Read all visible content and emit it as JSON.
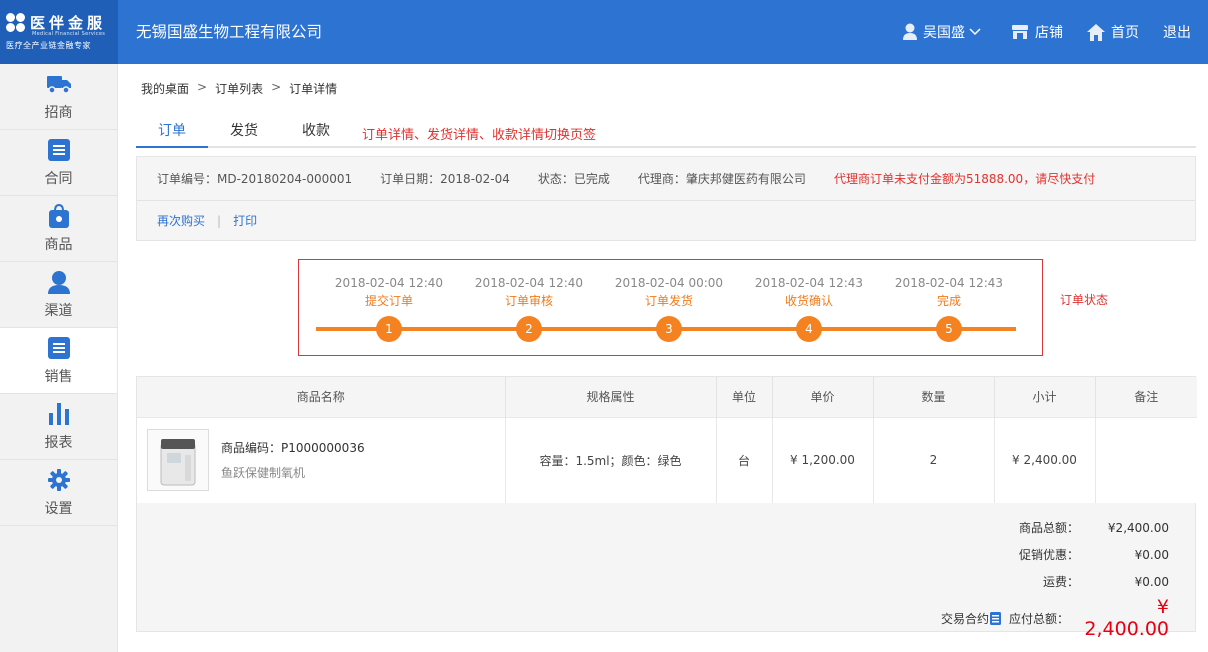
{
  "brand": {
    "name": "医伴金服",
    "name_en": "Medical Financial Services",
    "tagline": "医疗全产业链金融专家"
  },
  "header": {
    "company": "无锡国盛生物工程有限公司",
    "user": "吴国盛",
    "shop": "店铺",
    "home": "首页",
    "logout": "退出"
  },
  "sidebar": {
    "items": [
      {
        "label": "招商",
        "icon": "truck-icon"
      },
      {
        "label": "合同",
        "icon": "document-icon"
      },
      {
        "label": "商品",
        "icon": "shopping-bag-icon"
      },
      {
        "label": "渠道",
        "icon": "user-icon"
      },
      {
        "label": "销售",
        "icon": "list-icon",
        "active": true
      },
      {
        "label": "报表",
        "icon": "bar-chart-icon"
      },
      {
        "label": "设置",
        "icon": "gear-icon"
      }
    ]
  },
  "breadcrumb": [
    "我的桌面",
    "订单列表",
    "订单详情"
  ],
  "tabs": [
    "订单",
    "发货",
    "收款"
  ],
  "tab_note": "订单详情、发货详情、收款详情切换页签",
  "order": {
    "number": "订单编号：MD-20180204-000001",
    "date": "订单日期：2018-02-04",
    "status": "状态：已完成",
    "agent": "代理商：肇庆邦健医药有限公司",
    "warning": "代理商订单未支付金额为51888.00，请尽快支付",
    "buy_again": "再次购买",
    "print": "打印"
  },
  "steps": [
    {
      "time": "2018-02-04 12:40",
      "label": "提交订单",
      "num": "1"
    },
    {
      "time": "2018-02-04 12:40",
      "label": "订单审核",
      "num": "2"
    },
    {
      "time": "2018-02-04 00:00",
      "label": "订单发货",
      "num": "3"
    },
    {
      "time": "2018-02-04 12:43",
      "label": "收货确认",
      "num": "4"
    },
    {
      "time": "2018-02-04 12:43",
      "label": "完成",
      "num": "5"
    }
  ],
  "status_note": "订单状态",
  "table": {
    "headers": [
      "商品名称",
      "规格属性",
      "单位",
      "单价",
      "数量",
      "小计",
      "备注"
    ],
    "rows": [
      {
        "code": "商品编码：P1000000036",
        "name": "鱼跃保健制氧机",
        "spec": "容量：1.5ml；颜色：绿色",
        "unit": "台",
        "price": "¥ 1,200.00",
        "qty": "2",
        "subtotal": "¥ 2,400.00",
        "note": ""
      }
    ]
  },
  "totals": {
    "goods_label": "商品总额：",
    "goods_value": "¥2,400.00",
    "promo_label": "促销优惠：",
    "promo_value": "¥0.00",
    "freight_label": "运费：",
    "freight_value": "¥0.00",
    "contract_label": "交易合约",
    "pay_label": "应付总额：",
    "pay_value": "¥ 2,400.00"
  },
  "colors": {
    "header_blue": "#2d73d1",
    "step_orange": "#f58220",
    "warning_red": "#e0322f"
  }
}
